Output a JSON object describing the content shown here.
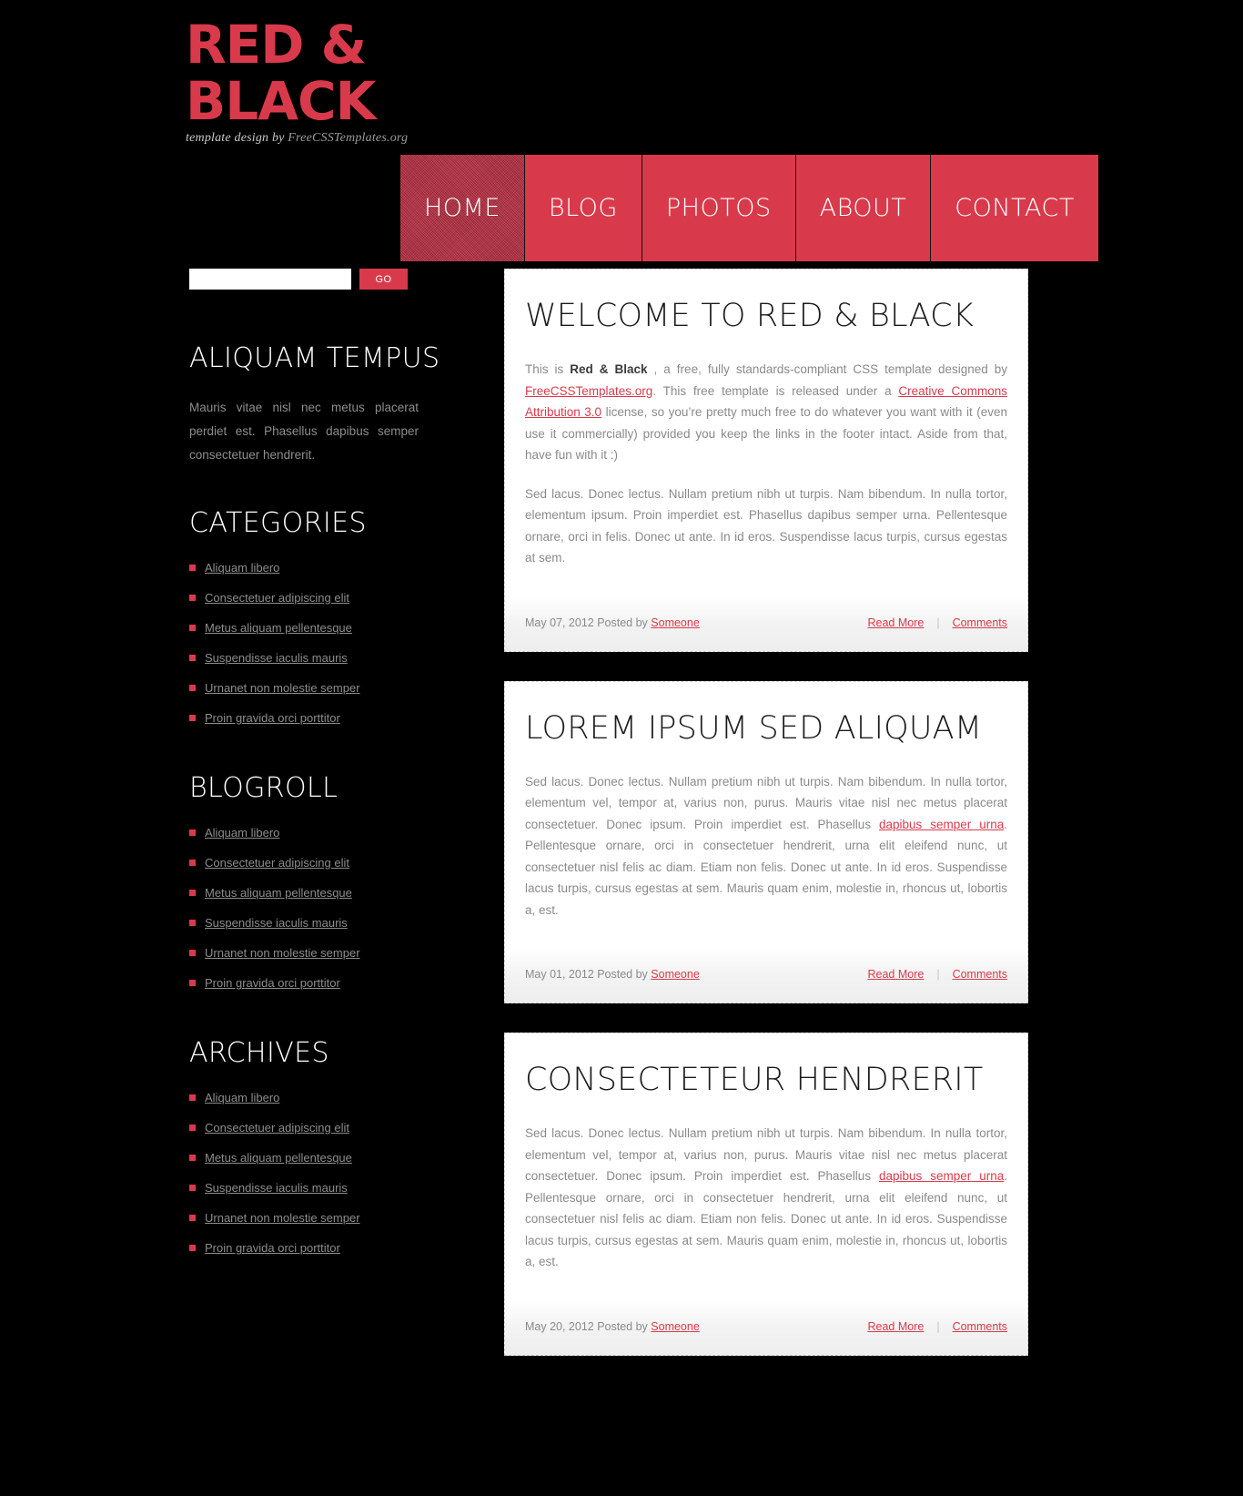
{
  "site": {
    "logo_line1": "RED &",
    "logo_line2": "BLACK",
    "tagline_prefix": "template design by ",
    "tagline_site": "FreeCSSTemplates.org",
    "accent_color": "#d93a4b",
    "background_color": "#000000"
  },
  "nav": {
    "items": [
      {
        "label": "HOME",
        "active": true
      },
      {
        "label": "BLOG",
        "active": false
      },
      {
        "label": "PHOTOS",
        "active": false
      },
      {
        "label": "ABOUT",
        "active": false
      },
      {
        "label": "CONTACT",
        "active": false
      }
    ]
  },
  "search": {
    "value": "",
    "placeholder": "",
    "button_label": "GO"
  },
  "sidebar": {
    "about": {
      "heading": "ALIQUAM TEMPUS",
      "text": "Mauris vitae nisl nec metus placerat perdiet est. Phasellus dapibus semper consectetuer hendrerit."
    },
    "categories": {
      "heading": "CATEGORIES",
      "items": [
        "Aliquam libero",
        "Consectetuer adipiscing elit",
        "Metus aliquam pellentesque",
        "Suspendisse iaculis mauris",
        "Urnanet non molestie semper",
        "Proin gravida orci porttitor"
      ]
    },
    "blogroll": {
      "heading": "BLOGROLL",
      "items": [
        "Aliquam libero",
        "Consectetuer adipiscing elit",
        "Metus aliquam pellentesque",
        "Suspendisse iaculis mauris",
        "Urnanet non molestie semper",
        "Proin gravida orci porttitor"
      ]
    },
    "archives": {
      "heading": "ARCHIVES",
      "items": [
        "Aliquam libero",
        "Consectetuer adipiscing elit",
        "Metus aliquam pellentesque",
        "Suspendisse iaculis mauris",
        "Urnanet non molestie semper",
        "Proin gravida orci porttitor"
      ]
    }
  },
  "posts": [
    {
      "title": "WELCOME TO RED & BLACK",
      "para1": {
        "t1": "This is ",
        "b1": "Red & Black",
        "t2": " , a free, fully standards-compliant CSS template designed by ",
        "a1": "FreeCSSTemplates.org",
        "t3": ". This free template is released under a ",
        "a2": "Creative Commons Attribution 3.0",
        "t4": " license, so you’re pretty much free to do whatever you want with it (even use it commercially) provided you keep the links in the footer intact. Aside from that, have fun with it :)"
      },
      "para2": "Sed lacus. Donec lectus. Nullam pretium nibh ut turpis. Nam bibendum. In nulla tortor, elementum ipsum. Proin imperdiet est. Phasellus dapibus semper urna. Pellentesque ornare, orci in felis. Donec ut ante. In id eros. Suspendisse lacus turpis, cursus egestas at sem.",
      "date": "May 07, 2012 Posted by ",
      "author": "Someone",
      "read_more": "Read More",
      "separator": "|",
      "comments": "Comments"
    },
    {
      "title": "LOREM IPSUM SED ALIQUAM",
      "body": {
        "t1": "Sed lacus. Donec lectus. Nullam pretium nibh ut turpis. Nam bibendum. In nulla tortor, elementum vel, tempor at, varius non, purus. Mauris vitae nisl nec metus placerat consectetuer. Donec ipsum. Proin imperdiet est. Phasellus ",
        "a1": "dapibus semper urna",
        "t2": ". Pellentesque ornare, orci in consectetuer hendrerit, urna elit eleifend nunc, ut consectetuer nisl felis ac diam. Etiam non felis. Donec ut ante. In id eros. Suspendisse lacus turpis, cursus egestas at sem. Mauris quam enim, molestie in, rhoncus ut, lobortis a, est."
      },
      "date": "May 01, 2012 Posted by ",
      "author": "Someone",
      "read_more": "Read More",
      "separator": "|",
      "comments": "Comments"
    },
    {
      "title": "CONSECTETEUR HENDRERIT",
      "body": {
        "t1": "Sed lacus. Donec lectus. Nullam pretium nibh ut turpis. Nam bibendum. In nulla tortor, elementum vel, tempor at, varius non, purus. Mauris vitae nisl nec metus placerat consectetuer. Donec ipsum. Proin imperdiet est. Phasellus ",
        "a1": "dapibus semper urna",
        "t2": ". Pellentesque ornare, orci in consectetuer hendrerit, urna elit eleifend nunc, ut consectetuer nisl felis ac diam. Etiam non felis. Donec ut ante. In id eros. Suspendisse lacus turpis, cursus egestas at sem. Mauris quam enim, molestie in, rhoncus ut, lobortis a, est."
      },
      "date": "May 20, 2012 Posted by ",
      "author": "Someone",
      "read_more": "Read More",
      "separator": "|",
      "comments": "Comments"
    }
  ]
}
